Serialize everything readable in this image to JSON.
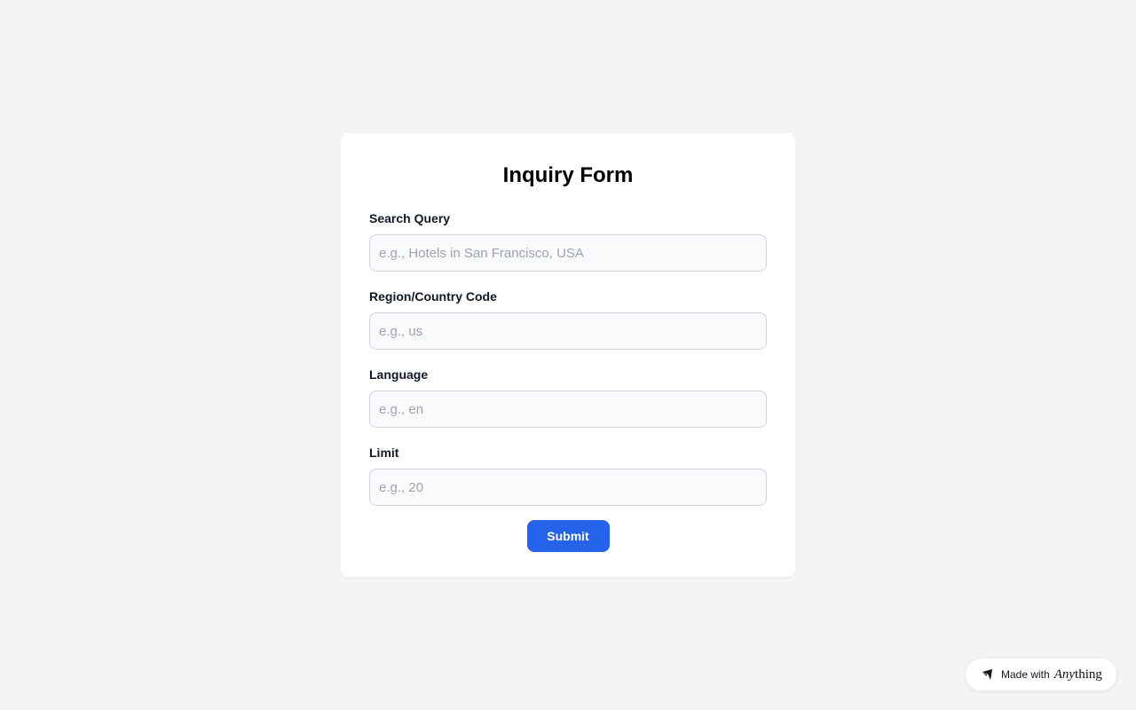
{
  "form": {
    "title": "Inquiry Form",
    "fields": [
      {
        "label": "Search Query",
        "placeholder": "e.g., Hotels in San Francisco, USA",
        "value": ""
      },
      {
        "label": "Region/Country Code",
        "placeholder": "e.g., us",
        "value": ""
      },
      {
        "label": "Language",
        "placeholder": "e.g., en",
        "value": ""
      },
      {
        "label": "Limit",
        "placeholder": "e.g., 20",
        "value": ""
      }
    ],
    "submit_label": "Submit"
  },
  "badge": {
    "made_with": "Made with",
    "brand_italic": "Any",
    "brand_rest": "thing",
    "icon": "anything-logo-icon"
  },
  "colors": {
    "background": "#f3f4f6",
    "card": "#ffffff",
    "accent": "#2563eb",
    "input_bg": "#f9fafb",
    "input_border": "#d1d5db",
    "placeholder": "#9ca3af"
  }
}
